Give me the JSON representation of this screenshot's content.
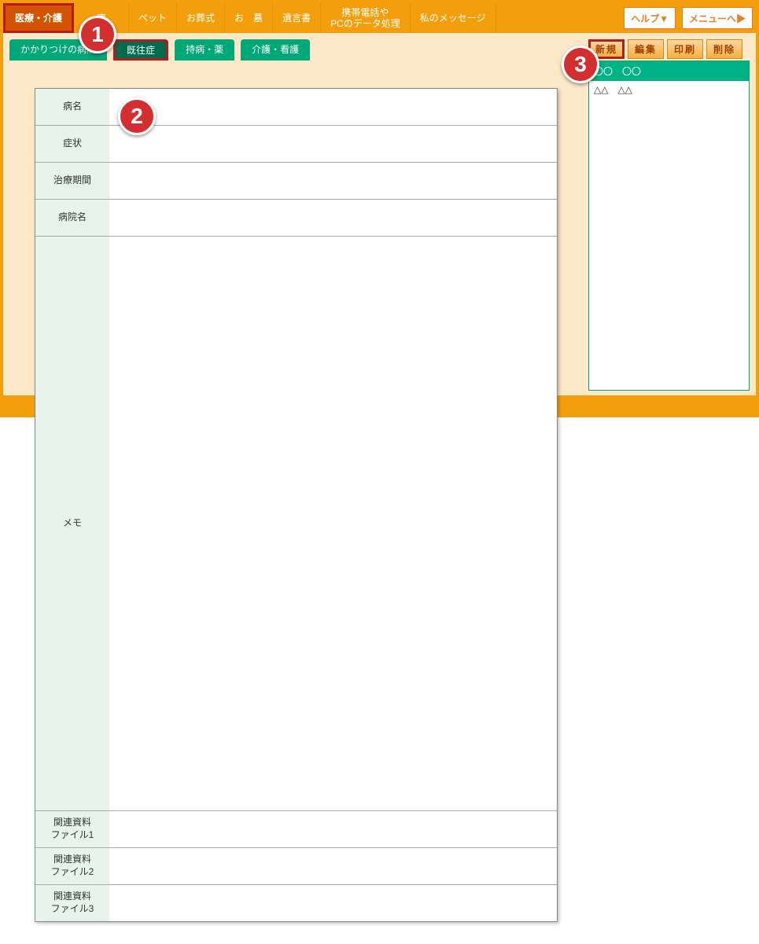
{
  "topnav": {
    "items": [
      "医療・介護",
      "療",
      "ペット",
      "お葬式",
      "お　墓",
      "遺言書",
      "携帯電話や\nPCのデータ処理",
      "私のメッセージ"
    ],
    "help": "ヘルプ▼",
    "menu": "メニューへ▶"
  },
  "tabs": [
    "かかりつけの病院",
    "既往症",
    "持病・薬",
    "介護・看護"
  ],
  "actions": {
    "new": "新規",
    "edit": "編集",
    "print": "印刷",
    "delete": "削除"
  },
  "list": {
    "header": "〇〇　〇〇",
    "item1": "△△　△△"
  },
  "form": {
    "labels": {
      "name": "病名",
      "symptom": "症状",
      "period": "治療期間",
      "hospital": "病院名",
      "memo": "メモ",
      "file1": "関連資料\nファイル1",
      "file2": "関連資料\nファイル2",
      "file3": "関連資料\nファイル3"
    }
  },
  "callouts": {
    "c1": "1",
    "c2": "2",
    "c3": "3"
  }
}
